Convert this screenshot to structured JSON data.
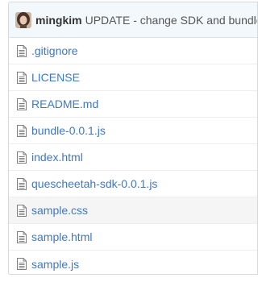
{
  "commit": {
    "author": "mingkim",
    "message": "UPDATE - change SDK and bundle"
  },
  "files": [
    {
      "name": ".gitignore",
      "icon": "file-text-icon",
      "highlighted": false
    },
    {
      "name": "LICENSE",
      "icon": "file-text-icon",
      "highlighted": false
    },
    {
      "name": "README.md",
      "icon": "file-text-icon",
      "highlighted": false
    },
    {
      "name": "bundle-0.0.1.js",
      "icon": "file-text-icon",
      "highlighted": false
    },
    {
      "name": "index.html",
      "icon": "file-text-icon",
      "highlighted": false
    },
    {
      "name": "quescheetah-sdk-0.0.1.js",
      "icon": "file-text-icon",
      "highlighted": false
    },
    {
      "name": "sample.css",
      "icon": "file-text-icon",
      "highlighted": true
    },
    {
      "name": "sample.html",
      "icon": "file-text-icon",
      "highlighted": false
    },
    {
      "name": "sample.js",
      "icon": "file-text-icon",
      "highlighted": false
    }
  ],
  "colors": {
    "link": "#4078c0",
    "commit_bar_bg": "#f2f8fc",
    "highlight_row_bg": "#f5f5f5"
  }
}
